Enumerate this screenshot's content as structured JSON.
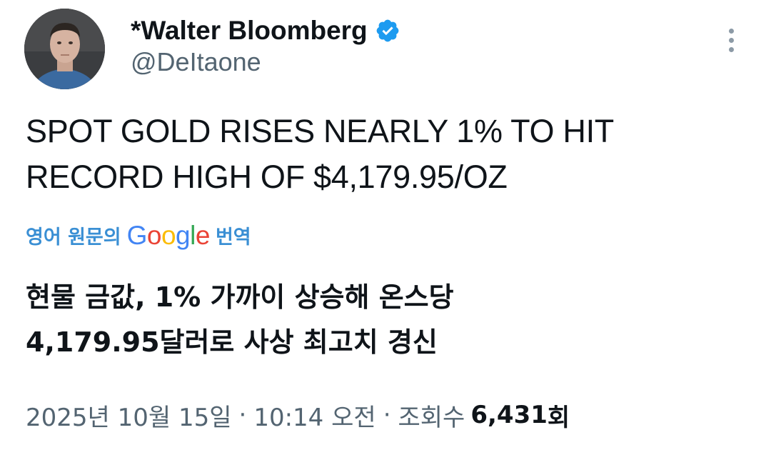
{
  "author": {
    "display_name": "*Walter Bloomberg",
    "handle": "@DeItaone",
    "verified": true,
    "avatar_icon": "user-avatar-photo"
  },
  "more_button": {
    "icon": "more-vertical-icon"
  },
  "tweet": {
    "text_lines": [
      "SPOT GOLD RISES NEARLY 1% TO HIT",
      "RECORD HIGH OF $4,179.95/OZ"
    ]
  },
  "translation": {
    "label_prefix": "영어 원문의",
    "provider": "Google",
    "label_suffix": "번역",
    "text_lines": [
      "현물 금값, 1% 가까이 상승해 온스당",
      "4,179.95달러로 사상 최고치 경신"
    ]
  },
  "meta": {
    "date": "2025년 10월 15일",
    "separator": "·",
    "time": "10:14 오전",
    "views_label": "조회수",
    "views_count": "6,431",
    "views_unit": "회"
  },
  "colors": {
    "link_blue": "#3a8fd4",
    "verified_blue": "#1d9bf0",
    "secondary_text": "#536471",
    "primary_text": "#0f1419"
  }
}
